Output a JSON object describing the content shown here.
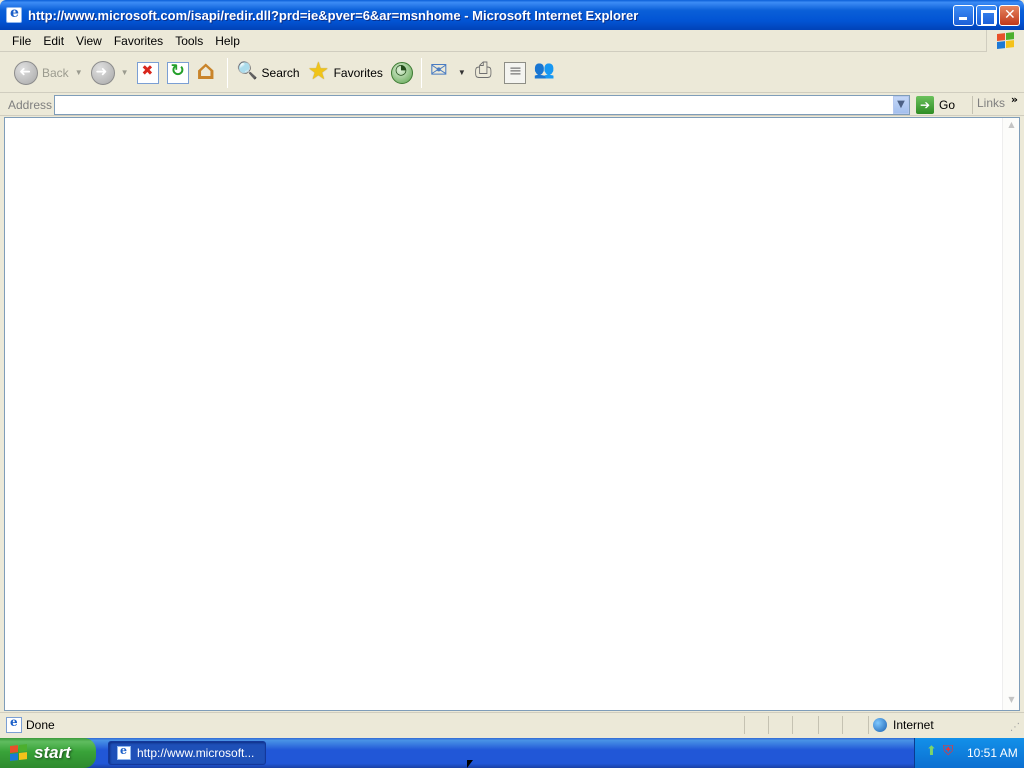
{
  "window": {
    "title": "http://www.microsoft.com/isapi/redir.dll?prd=ie&pver=6&ar=msnhome - Microsoft Internet Explorer"
  },
  "menu": {
    "items": [
      "File",
      "Edit",
      "View",
      "Favorites",
      "Tools",
      "Help"
    ]
  },
  "toolbar": {
    "back_label": "Back",
    "search_label": "Search",
    "favorites_label": "Favorites"
  },
  "address": {
    "label": "Address",
    "value": "",
    "go_label": "Go",
    "links_label": "Links"
  },
  "status": {
    "text": "Done",
    "zone": "Internet"
  },
  "taskbar": {
    "start_label": "start",
    "task_label": "http://www.microsoft...",
    "clock": "10:51 AM"
  },
  "colors": {
    "titlebar": "#0254d4",
    "taskbar": "#2157d7",
    "start": "#39a339",
    "chrome": "#ece9d8"
  },
  "icons": [
    "ie-icon",
    "back-icon",
    "forward-icon",
    "stop-icon",
    "refresh-icon",
    "home-icon",
    "search-icon",
    "favorites-icon",
    "history-icon",
    "mail-icon",
    "print-icon",
    "edit-icon",
    "messenger-icon",
    "go-icon",
    "globe-icon",
    "windows-logo-icon",
    "network-icon",
    "security-shield-icon"
  ]
}
